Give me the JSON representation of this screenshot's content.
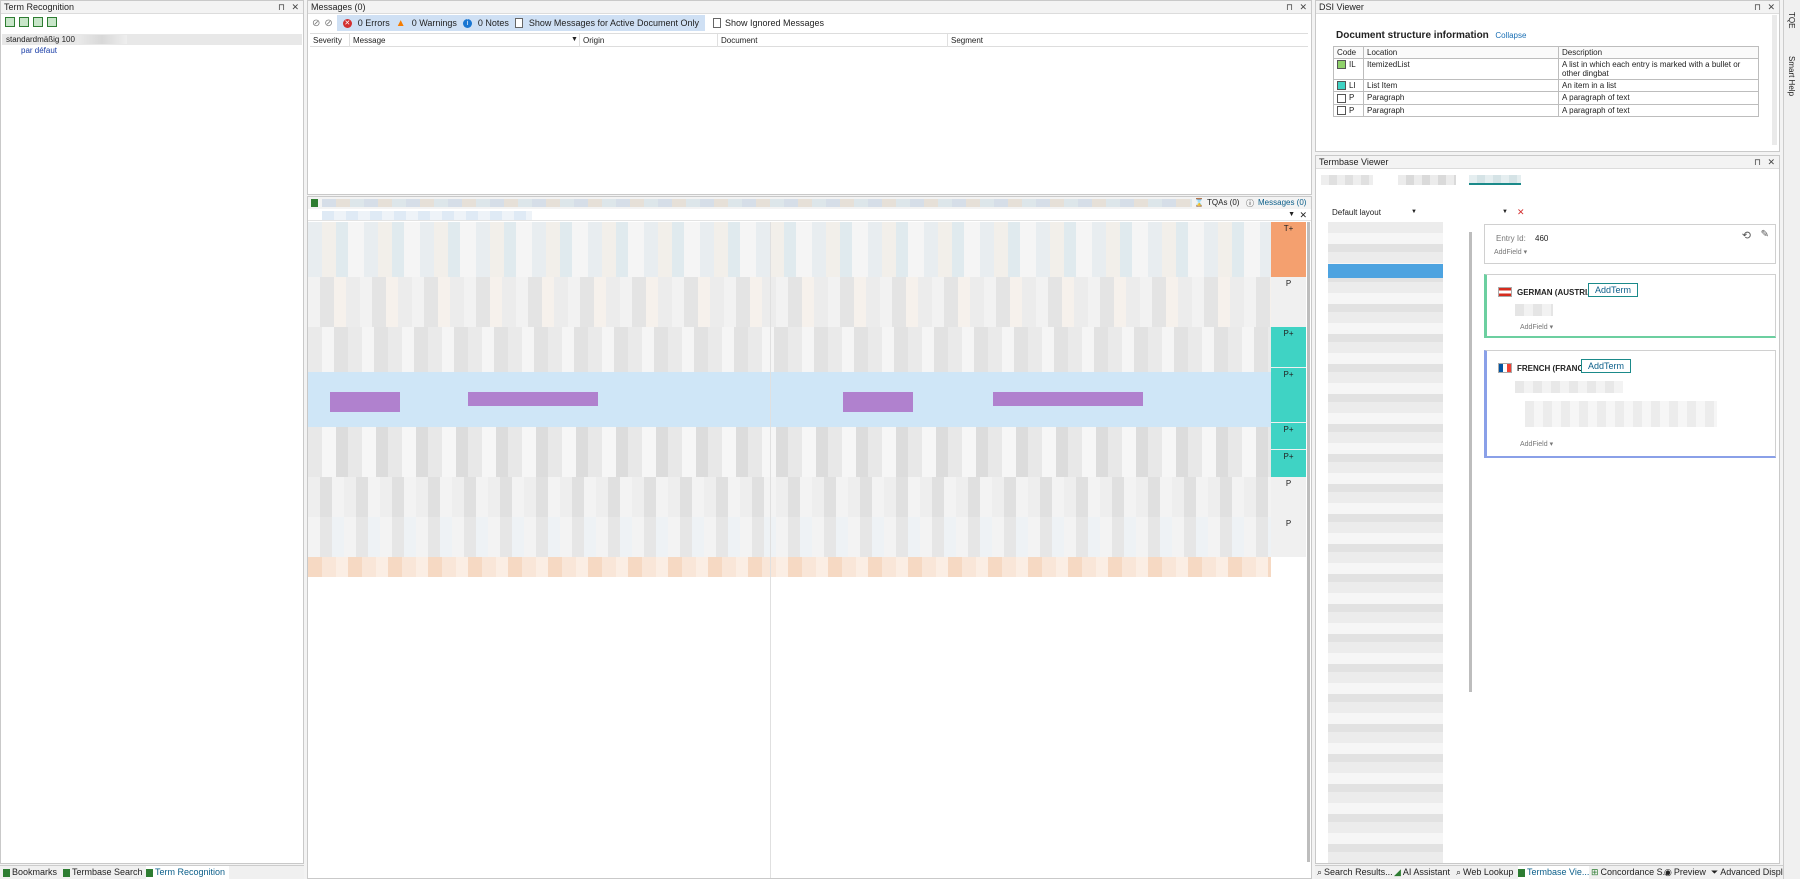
{
  "term_recognition": {
    "title": "Term Recognition",
    "entry_label": "standardmäßig",
    "entry_score": "100",
    "entry_sub": "par défaut"
  },
  "bottom_tabs_left": [
    {
      "label": "Bookmarks"
    },
    {
      "label": "Termbase Search"
    },
    {
      "label": "Term Recognition"
    }
  ],
  "messages": {
    "title": "Messages (0)",
    "errors": "0 Errors",
    "warnings": "0 Warnings",
    "notes": "0 Notes",
    "show_active": "Show Messages for Active Document Only",
    "show_ignored": "Show Ignored Messages",
    "columns": [
      "Severity",
      "Message",
      "Origin",
      "Document",
      "Segment"
    ]
  },
  "editor": {
    "tqa": "TQAs (0)",
    "messages": "Messages (0)",
    "status_labels": [
      "T+",
      "P",
      "P+",
      "P+",
      "P+",
      "P+",
      "P",
      "P"
    ]
  },
  "dsi": {
    "title": "DSI Viewer",
    "heading": "Document structure information",
    "collapse": "Collapse",
    "columns": [
      "Code",
      "Location",
      "Description"
    ],
    "rows": [
      {
        "code": "IL",
        "location": "ItemizedList",
        "description": "A list in which each entry is marked with a bullet or other dingbat",
        "color": "#8fd16a"
      },
      {
        "code": "LI",
        "location": "List Item",
        "description": "An item in a list",
        "color": "#3fd3c4"
      },
      {
        "code": "P",
        "location": "Paragraph",
        "description": "A paragraph of text",
        "color": "#ffffff"
      },
      {
        "code": "P",
        "location": "Paragraph",
        "description": "A paragraph of text",
        "color": "#ffffff"
      }
    ]
  },
  "termbase": {
    "title": "Termbase Viewer",
    "layout": "Default layout",
    "entry_id_label": "Entry Id:",
    "entry_id": "460",
    "add_field": "AddField",
    "lang1": "GERMAN (AUSTRIA)",
    "lang2": "FRENCH (FRANCE)",
    "add_term": "AddTerm"
  },
  "bottom_tabs_right": [
    {
      "label": "Search Results..."
    },
    {
      "label": "AI Assistant"
    },
    {
      "label": "Web Lookup"
    },
    {
      "label": "Termbase Vie..."
    },
    {
      "label": "Concordance S..."
    },
    {
      "label": "Preview"
    },
    {
      "label": "Advanced Displ..."
    }
  ],
  "side_tabs": [
    "TQE",
    "Smart Help"
  ],
  "colors": {
    "accent": "#0b5f8a",
    "tplus": "#f4a06f",
    "pplus": "#3fd3c4",
    "selection": "#cfe6f7"
  }
}
